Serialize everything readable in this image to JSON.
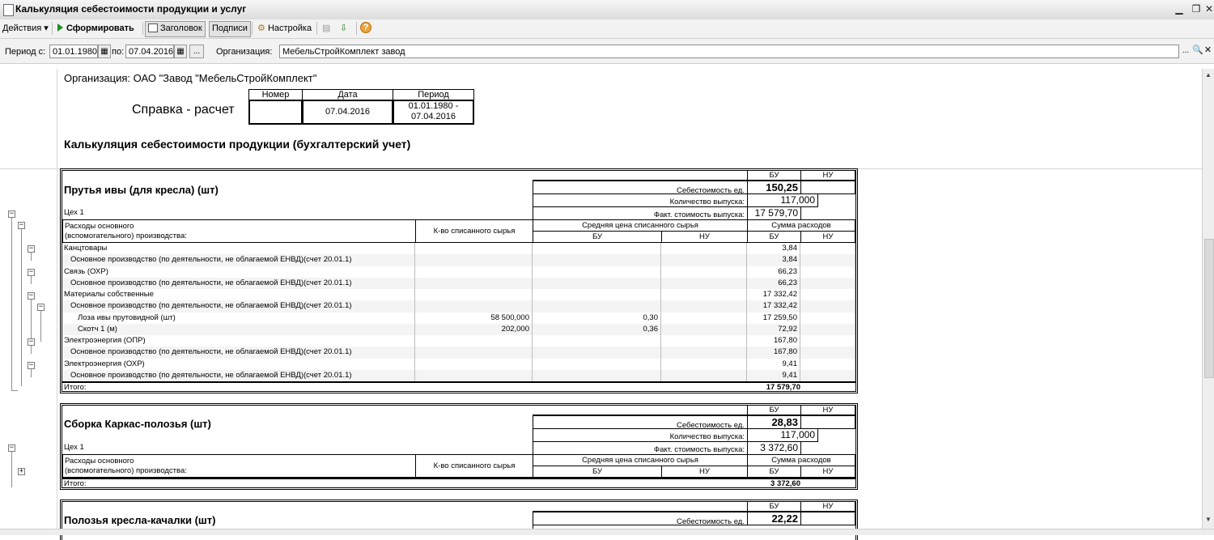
{
  "window": {
    "title": "Калькуляция себестоимости продукции и услуг"
  },
  "toolbar": {
    "actions": "Действия",
    "form": "Сформировать",
    "header": "Заголовок",
    "signatures": "Подписи",
    "settings": "Настройка"
  },
  "filters": {
    "period_from_label": "Период с:",
    "period_from": "01.01.1980",
    "period_to_label": "по:",
    "period_to": "07.04.2016",
    "org_label": "Организация:",
    "org_value": "МебельСтройКомплект завод"
  },
  "report": {
    "org_line": "Организация: ОАО \"Завод \"МебельСтройКомплект\"",
    "doc_title": "Справка - расчет",
    "doc_table": {
      "col_number": "Номер",
      "col_date": "Дата",
      "col_period": "Период",
      "number": "",
      "date": "07.04.2016",
      "period_line1": "01.01.1980 -",
      "period_line2": "07.04.2016"
    },
    "main_title": "Калькуляция себестоимости продукции (бухгалтерский учет)",
    "common": {
      "bu": "БУ",
      "nu": "НУ",
      "unit_cost": "Себестоимость ед.",
      "output_qty": "Количество выпуска:",
      "fact_cost": "Факт. стоимость выпуска:",
      "expenses_line1": "Расходы основного",
      "expenses_line2": "(вспомогательного) производства:",
      "qty_written_off": "К-во списанного сырья",
      "avg_price": "Средняя цена списанного сырья",
      "sum_expenses": "Сумма расходов",
      "total": "Итого:"
    },
    "blocks": [
      {
        "product": "Прутья ивы (для кресла) (шт)",
        "workshop": "Цех 1",
        "unit_cost": "150,25",
        "output_qty": "117,000",
        "fact_cost": "17 579,70",
        "total": "17 579,70",
        "rows": [
          {
            "name": "Канцтовары",
            "qty": "",
            "price_bu": "",
            "price_nu": "",
            "sum_bu": "3,84",
            "sum_nu": ""
          },
          {
            "name": "Основное производство (по деятельности, не облагаемой ЕНВД)(счет 20.01.1)",
            "qty": "",
            "price_bu": "",
            "price_nu": "",
            "sum_bu": "3,84",
            "sum_nu": ""
          },
          {
            "name": "Связь (ОХР)",
            "qty": "",
            "price_bu": "",
            "price_nu": "",
            "sum_bu": "66,23",
            "sum_nu": ""
          },
          {
            "name": "Основное производство (по деятельности, не облагаемой ЕНВД)(счет 20.01.1)",
            "qty": "",
            "price_bu": "",
            "price_nu": "",
            "sum_bu": "66,23",
            "sum_nu": ""
          },
          {
            "name": "Материалы собственные",
            "qty": "",
            "price_bu": "",
            "price_nu": "",
            "sum_bu": "17 332,42",
            "sum_nu": ""
          },
          {
            "name": "Основное производство (по деятельности, не облагаемой ЕНВД)(счет 20.01.1)",
            "qty": "",
            "price_bu": "",
            "price_nu": "",
            "sum_bu": "17 332,42",
            "sum_nu": ""
          },
          {
            "name": "Лоза ивы прутовидной (шт)",
            "qty": "58 500,000",
            "price_bu": "0,30",
            "price_nu": "",
            "sum_bu": "17 259,50",
            "sum_nu": ""
          },
          {
            "name": "Скотч 1 (м)",
            "qty": "202,000",
            "price_bu": "0,36",
            "price_nu": "",
            "sum_bu": "72,92",
            "sum_nu": ""
          },
          {
            "name": "Электроэнергия (ОПР)",
            "qty": "",
            "price_bu": "",
            "price_nu": "",
            "sum_bu": "167,80",
            "sum_nu": ""
          },
          {
            "name": "Основное производство (по деятельности, не облагаемой ЕНВД)(счет 20.01.1)",
            "qty": "",
            "price_bu": "",
            "price_nu": "",
            "sum_bu": "167,80",
            "sum_nu": ""
          },
          {
            "name": "Электроэнергия (ОХР)",
            "qty": "",
            "price_bu": "",
            "price_nu": "",
            "sum_bu": "9,41",
            "sum_nu": ""
          },
          {
            "name": "Основное производство (по деятельности, не облагаемой ЕНВД)(счет 20.01.1)",
            "qty": "",
            "price_bu": "",
            "price_nu": "",
            "sum_bu": "9,41",
            "sum_nu": ""
          }
        ]
      },
      {
        "product": "Сборка Каркас-полозья (шт)",
        "workshop": "Цех 1",
        "unit_cost": "28,83",
        "output_qty": "117,000",
        "fact_cost": "3 372,60",
        "total": "3 372,60"
      },
      {
        "product": "Полозья кресла-качалки (шт)",
        "unit_cost": "22,22"
      }
    ]
  }
}
